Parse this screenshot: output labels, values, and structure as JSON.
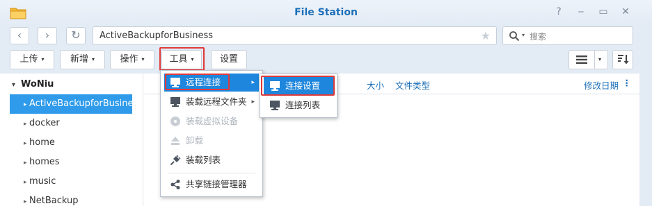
{
  "window": {
    "title": "File Station",
    "help_glyph": "?",
    "minimize_glyph": "‒",
    "maximize_glyph": "▭",
    "close_glyph": "✕"
  },
  "nav": {
    "back_glyph": "‹",
    "forward_glyph": "›",
    "refresh_glyph": "↻",
    "path": "ActiveBackupforBusiness",
    "favorite_glyph": "★",
    "search_placeholder": "搜索"
  },
  "toolbar": {
    "upload": "上传",
    "create": "新增",
    "action": "操作",
    "tools": "工具",
    "settings": "设置",
    "caret": "▾"
  },
  "sidebar": {
    "root": "WoNiu",
    "root_glyph": "▾",
    "item_glyph": "▸",
    "items": [
      {
        "label": "ActiveBackupforBusiness"
      },
      {
        "label": "docker"
      },
      {
        "label": "home"
      },
      {
        "label": "homes"
      },
      {
        "label": "music"
      },
      {
        "label": "NetBackup"
      }
    ]
  },
  "columns": {
    "size": "大小",
    "type": "文件类型",
    "modified": "修改日期",
    "menu_glyph": "⋮"
  },
  "tools_menu": {
    "arrow": "▸",
    "items": [
      {
        "label": "远程连接"
      },
      {
        "label": "装载远程文件夹"
      },
      {
        "label": "装载虚拟设备"
      },
      {
        "label": "卸载"
      },
      {
        "label": "装载列表"
      },
      {
        "label": "共享链接管理器"
      }
    ]
  },
  "remote_submenu": {
    "items": [
      {
        "label": "连接设置"
      },
      {
        "label": "连接列表"
      }
    ]
  },
  "colors": {
    "accent": "#1e86dc",
    "title": "#1d6fb8",
    "selection": "#2f9bea",
    "highlight_border": "#e03a3a"
  }
}
